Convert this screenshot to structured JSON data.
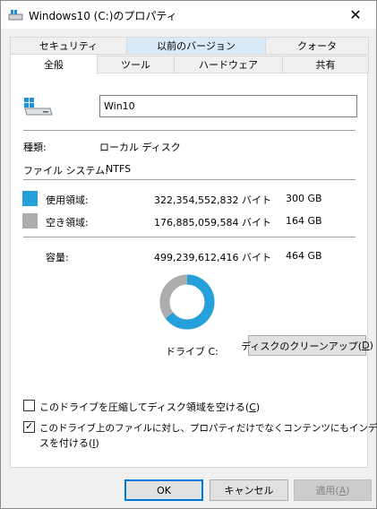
{
  "window": {
    "title": "Windows10 (C:)のプロパティ",
    "close_glyph": "✕"
  },
  "tabs_row1": [
    {
      "label": "セキュリティ"
    },
    {
      "label": "以前のバージョン"
    },
    {
      "label": "クォータ"
    }
  ],
  "tabs_row2": [
    {
      "label": "全般"
    },
    {
      "label": "ツール"
    },
    {
      "label": "ハードウェア"
    },
    {
      "label": "共有"
    }
  ],
  "general": {
    "drive_name": "Win10",
    "type_label": "種類:",
    "type_value": "ローカル ディスク",
    "fs_label": "ファイル システム:",
    "fs_value": "NTFS",
    "used": {
      "label": "使用領域:",
      "bytes": "322,354,552,832 バイト",
      "size": "300 GB",
      "color": "#26a0da"
    },
    "free": {
      "label": "空き領域:",
      "bytes": "176,885,059,584 バイト",
      "size": "164 GB",
      "color": "#adadad"
    },
    "capacity": {
      "label": "容量:",
      "bytes": "499,239,612,416 バイト",
      "size": "464 GB"
    },
    "drive_label": "ドライブ C:",
    "cleanup_button": {
      "text": "ディスクのクリーンアップ(",
      "mnemonic": "D",
      "suffix": ")"
    },
    "compress_option": {
      "text": "このドライブを圧縮してディスク領域を空ける(",
      "mnemonic": "C",
      "suffix": ")",
      "checked": false
    },
    "index_option": {
      "line1": "このドライブ上のファイルに対し、プロパティだけでなくコンテンツにもインデック",
      "line2": "スを付ける(",
      "mnemonic": "I",
      "suffix": ")",
      "checked": true,
      "check_glyph": "✓"
    },
    "donut": {
      "used_fraction": 0.6457
    }
  },
  "footer": {
    "ok": "OK",
    "cancel": "キャンセル",
    "apply": {
      "text": "適用(",
      "mnemonic": "A",
      "suffix": ")"
    }
  }
}
